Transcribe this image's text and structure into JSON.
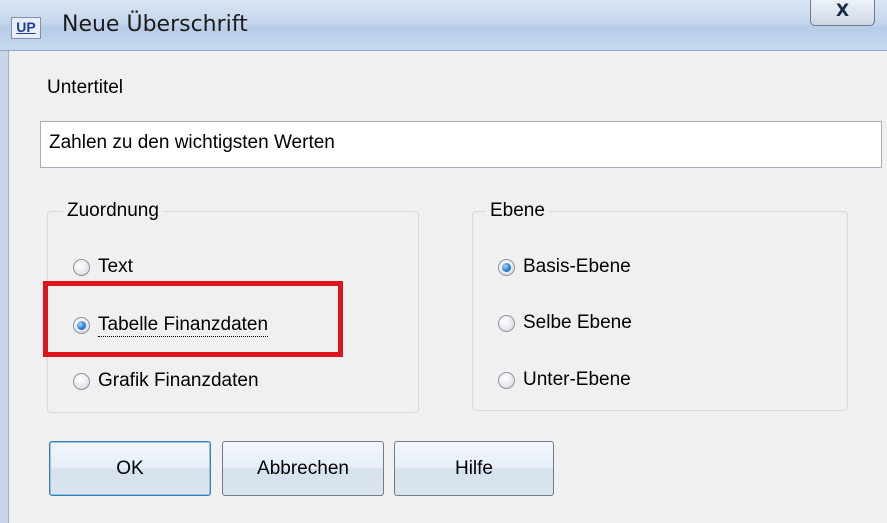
{
  "window": {
    "app_icon": "UP",
    "title": "Neue Überschrift",
    "close_glyph": "X"
  },
  "subtitle": {
    "label": "Untertitel",
    "value": "Zahlen zu den wichtigsten Werten"
  },
  "zuordnung": {
    "caption": "Zuordnung",
    "options": [
      {
        "label": "Text",
        "checked": false
      },
      {
        "label": "Tabelle Finanzdaten",
        "checked": true
      },
      {
        "label": "Grafik Finanzdaten",
        "checked": false
      }
    ]
  },
  "ebene": {
    "caption": "Ebene",
    "options": [
      {
        "label": "Basis-Ebene",
        "checked": true
      },
      {
        "label": "Selbe Ebene",
        "checked": false
      },
      {
        "label": "Unter-Ebene",
        "checked": false
      }
    ]
  },
  "buttons": {
    "ok": "OK",
    "cancel": "Abbrechen",
    "help": "Hilfe"
  },
  "colors": {
    "highlight": "#e0141b",
    "titlebar": "#c5d7ec",
    "radio_selected": "#2a7fd4"
  }
}
